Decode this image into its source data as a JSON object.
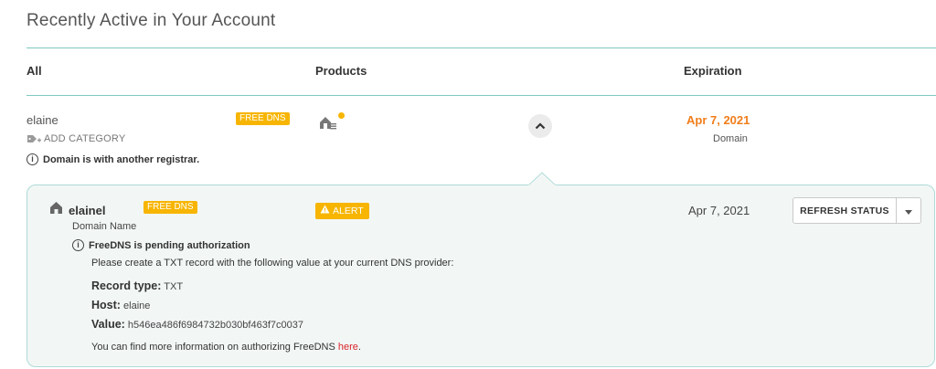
{
  "page": {
    "title": "Recently Active in Your Account"
  },
  "columns": {
    "all": "All",
    "products": "Products",
    "expiration": "Expiration"
  },
  "row": {
    "name": "elaine",
    "badge": "FREE DNS",
    "add_category": "ADD CATEGORY",
    "notice": "Domain is with another registrar.",
    "expiration_date": "Apr 7, 2021",
    "expiration_type": "Domain",
    "product_icon": "house-icon",
    "status_dot_color": "#f7b500"
  },
  "detail": {
    "name": "elainel",
    "badge": "FREE DNS",
    "subtitle": "Domain Name",
    "alert_label": "ALERT",
    "date": "Apr 7, 2021",
    "refresh_label": "REFRESH STATUS",
    "pending_title": "FreeDNS is pending authorization",
    "instruction": "Please create a TXT record with the following value at your current DNS provider:",
    "record_type_label": "Record type:",
    "record_type_value": "TXT",
    "host_label": "Host:",
    "host_value": "elaine",
    "value_label": "Value:",
    "value_value": "h546ea486f6984732b030bf463f7c0037",
    "more_text": "You can find more information on authorizing FreeDNS ",
    "more_link": "here",
    "more_end": "."
  },
  "colors": {
    "accent_teal": "#7fc9c2",
    "badge_yellow": "#f7b500",
    "date_orange": "#f07d1a",
    "link_red": "#d9252a"
  }
}
